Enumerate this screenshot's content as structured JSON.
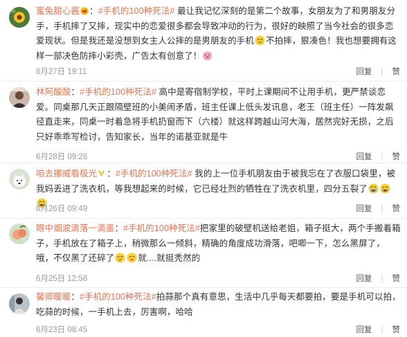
{
  "actions": {
    "reply": "回复",
    "like": "赞"
  },
  "colors": {
    "username": "#eb7350",
    "text": "#333333",
    "meta": "#999999"
  },
  "comments": [
    {
      "user": "蜜兔甜心酱",
      "topic": "#手机的100种死法#",
      "parts": [
        " 最让我记忆深刻的是第二个故事，女朋友为了和男朋友分手，手机摔了又摔，现实中的恋爱很多都会导致冲动的行为，很好的映照了当今社会的很多恋爱现状。但是我还是没想到女主人公摔的是男朋友的手机",
        "不拍摔，狠凑色！我也想要拥有这样一部决色防摔小彩壳，广告太有创意了！"
      ],
      "time": "6月27日 19:11"
    },
    {
      "user": "林阿酸酸",
      "topic": "#手机的100种死法#",
      "parts": [
        " 高中是寄宿制学校，平时上课期间不让用手机，更严禁谈恋爱。同桌那几天正跟隔壁班的小美闹矛盾，班主任课上低头发讯息，老王（班主任）一阵发飙径直走来，同桌一时着急将手机扔窗而下（六楼）就这样跨越山河大海，居然完好无损，之后只好乖乖写检讨，告知家长，当年的诺基亚就是牛"
      ],
      "time": "6月28日 09:26"
    },
    {
      "user": "咱去挪威看极光",
      "topic": "#手机的100种死法#",
      "parts": [
        " 我的上一位手机朋友由于被我忘在了衣服口袋里，被我妈丢进了洗衣机，等我想起来的时候，它已经壮烈的牺牲在了洗衣机里，四分五裂了"
      ],
      "time": "6月26日 09:49"
    },
    {
      "user": "眼中烟波滴落一滴墨",
      "topic": "#手机的100种死法#",
      "parts": [
        "把家里的破壁机送给老姐，箱子挺大，两个手搬着箱子，手机放在了箱子上，稍微那么一倾斜，精确的角度成功滑落，吧唧一下，怎么黑屏了，哦，不仅黑了还碎了",
        "就....就挺秃然的"
      ],
      "time": "6月25日 12:58"
    },
    {
      "user": "馨卿暖暖",
      "topic": "#手机的100种死法#",
      "parts": [
        "拍蒜那个真有意思，生活中几乎每天都要拍，要是手机可以拍，吃蒜的时候，一手机上去，厉害啊，哈哈"
      ],
      "time": "6月23日 08:45"
    }
  ]
}
